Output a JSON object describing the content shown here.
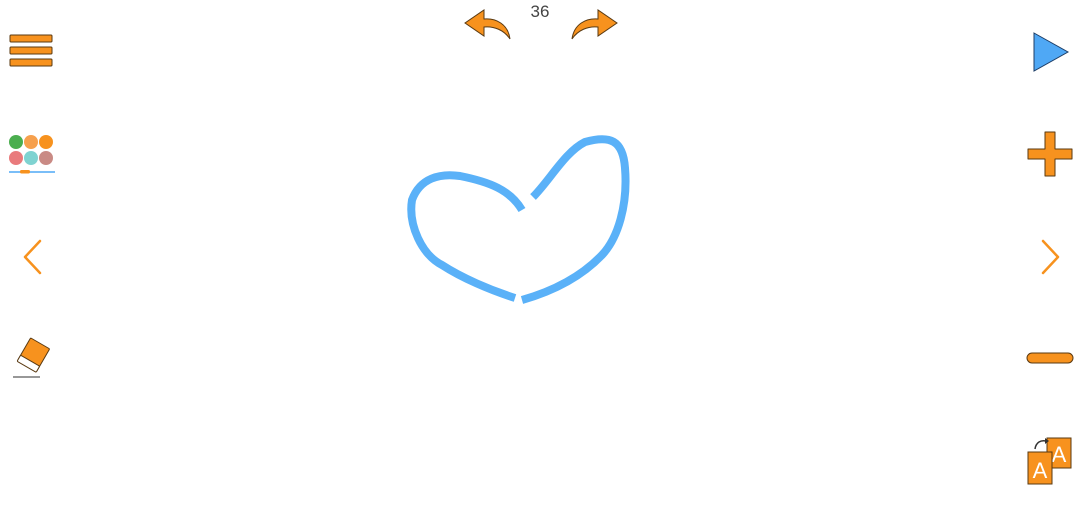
{
  "toolbar_top": {
    "page_number": "36"
  },
  "colors": {
    "accent": "#F7921E",
    "accent_outline": "#5a3a12",
    "play": "#4FA8F5",
    "stroke": "#5AB1F8"
  },
  "palette_swatches": [
    "#4BAE4F",
    "#F6A04D",
    "#F7921E",
    "#E97A7C",
    "#7FD3D1",
    "#C98A84"
  ],
  "icons": {
    "menu": "menu-icon",
    "palette": "color-palette-icon",
    "prev": "chevron-left-icon",
    "eraser": "eraser-icon",
    "play": "play-icon",
    "plus": "plus-icon",
    "next": "chevron-right-icon",
    "minus": "minus-icon",
    "font_size": "font-size-icon",
    "undo": "undo-icon",
    "redo": "redo-icon"
  },
  "font_size_icon": {
    "letter_small": "A",
    "letter_large": "A"
  }
}
